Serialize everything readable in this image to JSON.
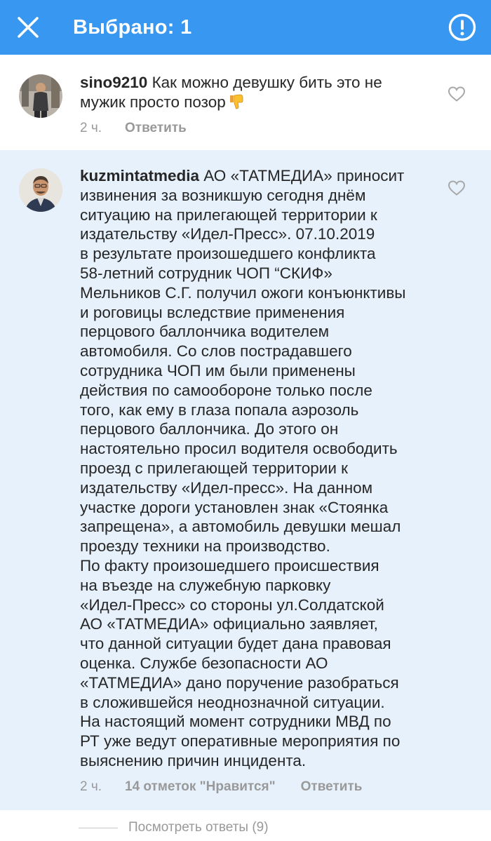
{
  "header": {
    "title": "Выбрано: 1",
    "close_icon": "close-icon",
    "report_icon": "alert-circle-icon",
    "background": "#3897f0"
  },
  "comments": [
    {
      "username": "sino9210",
      "text": " Как можно девушку бить это не\nмужик просто позор",
      "emoji": "thumbs-down-emoji",
      "time": "2 ч.",
      "likes": "",
      "reply_label": "Ответить"
    },
    {
      "username": "kuzmintatmedia",
      "text": " АО «ТАТМЕДИА» приносит\nизвинения за возникшую сегодня днём\nситуацию на прилегающей территории к\nиздательству «Идел-Пресс». 07.10.2019\nв результате произошедшего конфликта\n58-летний сотрудник ЧОП “СКИФ»\nМельников С.Г. получил ожоги конъюнктивы\nи роговицы вследствие применения\nперцового баллончика водителем\nавтомобиля. Со слов пострадавшего\nсотрудника ЧОП им были применены\nдействия по самообороне только после\nтого, как ему в глаза попала аэрозоль\nперцового баллончика. До этого он\nнастоятельно просил водителя освободить\nпроезд с прилегающей территории к\nиздательству «Идел-пресс». На данном\nучастке дороги установлен знак «Стоянка\nзапрещена», а автомобиль девушки мешал\nпроезду техники на производство.\nПо факту произошедшего происшествия\nна въезде на служебную парковку\n«Идел-Пресс» со стороны ул.Солдатской\nАО «ТАТМЕДИА» официально заявляет,\nчто данной ситуации будет дана правовая\nоценка. Службе безопасности АО\n«ТАТМЕДИА» дано поручение разобраться\nв сложившейся неоднозначной ситуации.\nНа настоящий момент сотрудники МВД по\nРТ уже ведут оперативные мероприятия по\nвыяснению причин инцидента.",
      "time": "2 ч.",
      "likes": "14 отметок \"Нравится\"",
      "reply_label": "Ответить",
      "highlight": "#e7f1fc"
    }
  ],
  "view_replies": "Посмотреть ответы (9)"
}
